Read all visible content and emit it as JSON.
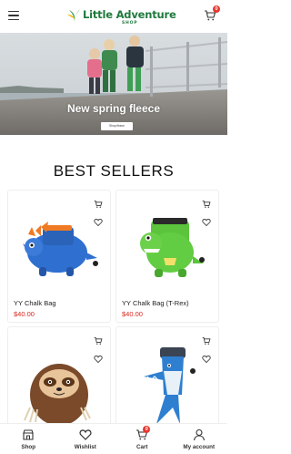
{
  "header": {
    "logo_text": "Little Adventure",
    "logo_sub": "SHOP",
    "cart_count": "0"
  },
  "hero": {
    "title": "New spring fleece",
    "button_label": "Shop fleece"
  },
  "section_title": "BEST SELLERS",
  "products": [
    {
      "name": "YY Chalk Bag",
      "price": "$40.00"
    },
    {
      "name": "YY Chalk Bag (T-Rex)",
      "price": "$40.00"
    },
    {
      "name": "",
      "price": ""
    },
    {
      "name": "",
      "price": ""
    }
  ],
  "bottom_nav": {
    "shop": "Shop",
    "wishlist": "Wishlist",
    "cart": "Cart",
    "cart_count": "0",
    "account": "My account"
  },
  "colors": {
    "brand_green": "#1f7a3d",
    "price_red": "#d9261c",
    "badge_red": "#e7372f"
  }
}
